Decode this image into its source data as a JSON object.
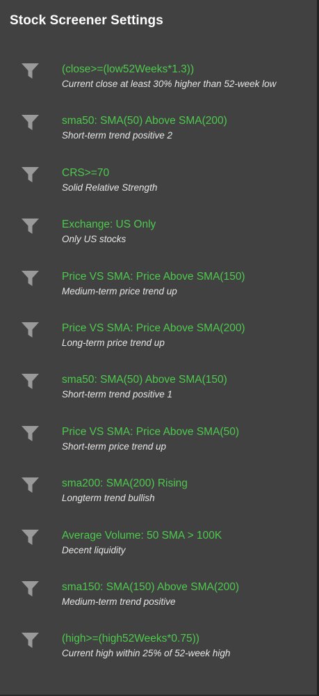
{
  "title": "Stock Screener Settings",
  "filters": [
    {
      "icon": "filter-icon",
      "expression": "(close>=(low52Weeks*1.3))",
      "description": "Current close at least 30% higher than 52-week low"
    },
    {
      "icon": "filter-icon",
      "expression": "sma50: SMA(50) Above SMA(200)",
      "description": "Short-term trend positive 2"
    },
    {
      "icon": "filter-icon",
      "expression": "CRS>=70",
      "description": "Solid Relative Strength"
    },
    {
      "icon": "filter-icon",
      "expression": "Exchange: US Only",
      "description": "Only US stocks"
    },
    {
      "icon": "filter-icon",
      "expression": "Price VS SMA: Price Above SMA(150)",
      "description": "Medium-term price trend up"
    },
    {
      "icon": "filter-icon",
      "expression": "Price VS SMA: Price Above SMA(200)",
      "description": "Long-term price trend up"
    },
    {
      "icon": "filter-icon",
      "expression": "sma50: SMA(50) Above SMA(150)",
      "description": "Short-term trend positive 1"
    },
    {
      "icon": "filter-icon",
      "expression": "Price VS SMA: Price Above SMA(50)",
      "description": "Short-term price trend up"
    },
    {
      "icon": "filter-icon",
      "expression": "sma200: SMA(200) Rising",
      "description": "Longterm trend bullish"
    },
    {
      "icon": "filter-icon",
      "expression": "Average Volume: 50 SMA > 100K",
      "description": "Decent liquidity"
    },
    {
      "icon": "filter-icon",
      "expression": "sma150: SMA(150) Above SMA(200)",
      "description": "Medium-term trend positive"
    },
    {
      "icon": "filter-icon",
      "expression": "(high>=(high52Weeks*0.75))",
      "description": "Current high within 25% of 52-week high"
    }
  ],
  "colors": {
    "background": "#414141",
    "title": "#ffffff",
    "expression": "#4ec94e",
    "description": "#e6e6e6",
    "icon": "#9a9a9a"
  }
}
